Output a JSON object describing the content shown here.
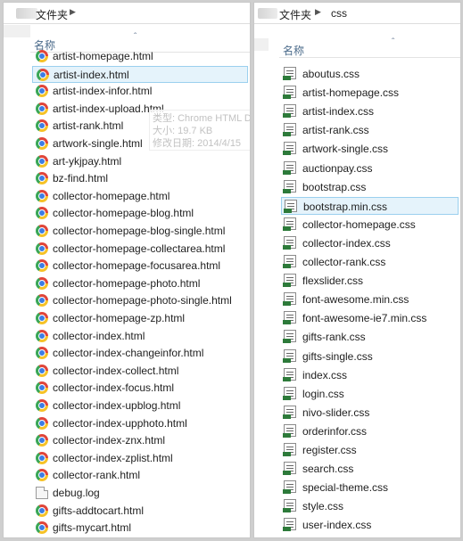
{
  "left_pane": {
    "breadcrumb": {
      "current": "文件夹"
    },
    "column_header": "名称",
    "selected_index": 1,
    "files": [
      {
        "name": "artist-homepage.html",
        "icon": "chrome-icon"
      },
      {
        "name": "artist-index.html",
        "icon": "chrome-icon"
      },
      {
        "name": "artist-index-infor.html",
        "icon": "chrome-icon"
      },
      {
        "name": "artist-index-upload.html",
        "icon": "chrome-icon"
      },
      {
        "name": "artist-rank.html",
        "icon": "chrome-icon"
      },
      {
        "name": "artwork-single.html",
        "icon": "chrome-icon"
      },
      {
        "name": "art-ykjpay.html",
        "icon": "chrome-icon"
      },
      {
        "name": "bz-find.html",
        "icon": "chrome-icon"
      },
      {
        "name": "collector-homepage.html",
        "icon": "chrome-icon"
      },
      {
        "name": "collector-homepage-blog.html",
        "icon": "chrome-icon"
      },
      {
        "name": "collector-homepage-blog-single.html",
        "icon": "chrome-icon"
      },
      {
        "name": "collector-homepage-collectarea.html",
        "icon": "chrome-icon"
      },
      {
        "name": "collector-homepage-focusarea.html",
        "icon": "chrome-icon"
      },
      {
        "name": "collector-homepage-photo.html",
        "icon": "chrome-icon"
      },
      {
        "name": "collector-homepage-photo-single.html",
        "icon": "chrome-icon"
      },
      {
        "name": "collector-homepage-zp.html",
        "icon": "chrome-icon"
      },
      {
        "name": "collector-index.html",
        "icon": "chrome-icon"
      },
      {
        "name": "collector-index-changeinfor.html",
        "icon": "chrome-icon"
      },
      {
        "name": "collector-index-collect.html",
        "icon": "chrome-icon"
      },
      {
        "name": "collector-index-focus.html",
        "icon": "chrome-icon"
      },
      {
        "name": "collector-index-upblog.html",
        "icon": "chrome-icon"
      },
      {
        "name": "collector-index-upphoto.html",
        "icon": "chrome-icon"
      },
      {
        "name": "collector-index-znx.html",
        "icon": "chrome-icon"
      },
      {
        "name": "collector-index-zplist.html",
        "icon": "chrome-icon"
      },
      {
        "name": "collector-rank.html",
        "icon": "chrome-icon"
      },
      {
        "name": "debug.log",
        "icon": "log-file-icon"
      },
      {
        "name": "gifts-addtocart.html",
        "icon": "chrome-icon"
      },
      {
        "name": "gifts-mycart.html",
        "icon": "chrome-icon"
      }
    ],
    "tooltip": {
      "line1": "类型: Chrome HTML D",
      "line2": "大小: 19.7 KB",
      "line3": "修改日期: 2014/4/15"
    }
  },
  "right_pane": {
    "breadcrumb": {
      "parent": "文件夹",
      "current": "css"
    },
    "column_header": "名称",
    "selected_index": 7,
    "files": [
      {
        "name": "aboutus.css",
        "icon": "css-file-icon"
      },
      {
        "name": "artist-homepage.css",
        "icon": "css-file-icon"
      },
      {
        "name": "artist-index.css",
        "icon": "css-file-icon"
      },
      {
        "name": "artist-rank.css",
        "icon": "css-file-icon"
      },
      {
        "name": "artwork-single.css",
        "icon": "css-file-icon"
      },
      {
        "name": "auctionpay.css",
        "icon": "css-file-icon"
      },
      {
        "name": "bootstrap.css",
        "icon": "css-file-icon"
      },
      {
        "name": "bootstrap.min.css",
        "icon": "css-file-icon"
      },
      {
        "name": "collector-homepage.css",
        "icon": "css-file-icon"
      },
      {
        "name": "collector-index.css",
        "icon": "css-file-icon"
      },
      {
        "name": "collector-rank.css",
        "icon": "css-file-icon"
      },
      {
        "name": "flexslider.css",
        "icon": "css-file-icon"
      },
      {
        "name": "font-awesome.min.css",
        "icon": "css-file-icon"
      },
      {
        "name": "font-awesome-ie7.min.css",
        "icon": "css-file-icon"
      },
      {
        "name": "gifts-rank.css",
        "icon": "css-file-icon"
      },
      {
        "name": "gifts-single.css",
        "icon": "css-file-icon"
      },
      {
        "name": "index.css",
        "icon": "css-file-icon"
      },
      {
        "name": "login.css",
        "icon": "css-file-icon"
      },
      {
        "name": "nivo-slider.css",
        "icon": "css-file-icon"
      },
      {
        "name": "orderinfor.css",
        "icon": "css-file-icon"
      },
      {
        "name": "register.css",
        "icon": "css-file-icon"
      },
      {
        "name": "search.css",
        "icon": "css-file-icon"
      },
      {
        "name": "special-theme.css",
        "icon": "css-file-icon"
      },
      {
        "name": "style.css",
        "icon": "css-file-icon"
      },
      {
        "name": "user-index.css",
        "icon": "css-file-icon"
      }
    ]
  }
}
